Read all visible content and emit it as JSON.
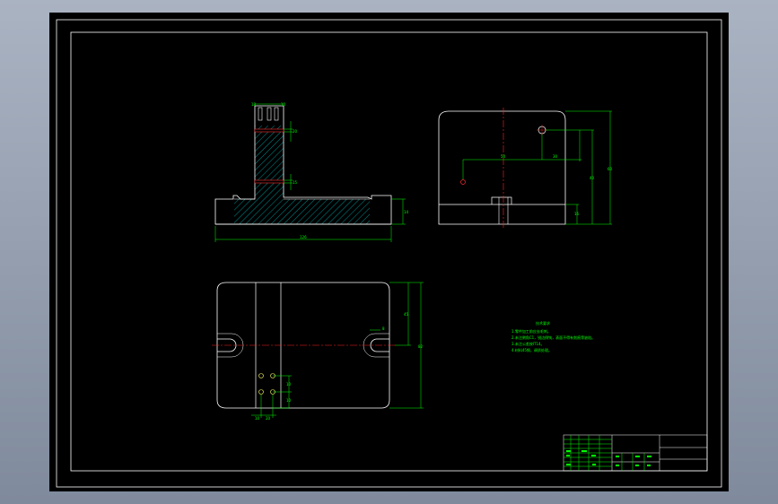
{
  "drawing": {
    "colors": {
      "background": "#000000",
      "outline": "#ffffff",
      "dimension": "#00ff00",
      "centerline": "#ff0000",
      "hatch": "#00d0d0",
      "text": "#00ff00",
      "viewport": "#a9b3c3"
    },
    "front_view": {
      "dims": {
        "top_w1": "18",
        "top_w2": "10",
        "slot_h1": "20",
        "slot_h2": "15",
        "base_h": "14",
        "total_w": "126"
      }
    },
    "side_view": {
      "dims": {
        "h1": "60",
        "h2": "40",
        "h3": "16",
        "w1": "50",
        "w2": "30"
      }
    },
    "top_view": {
      "dims": {
        "r": "8",
        "h1": "45",
        "h2": "82",
        "sx": "20",
        "sy1": "10",
        "sy2": "10",
        "bx": "10",
        "by": "12"
      }
    },
    "notes": {
      "title": "技术要求",
      "lines": [
        "1.零件加工前应去毛刺。",
        "2.未注倒角C1，锐边倒钝，表面不得有划痕等缺陷。",
        "3.未注公差按IT14。",
        "4.材料45钢，调质处理。"
      ]
    },
    "title_block": {
      "rows": 6
    }
  }
}
